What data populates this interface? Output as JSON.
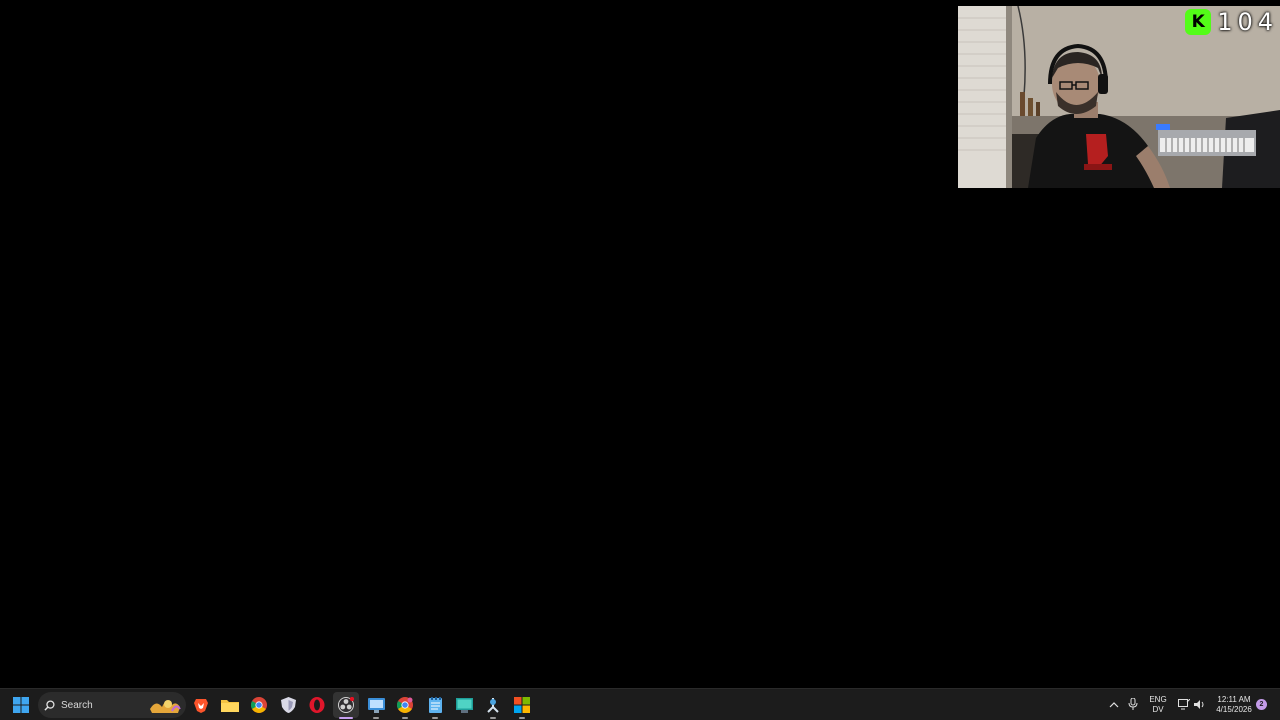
{
  "overlay": {
    "platform_icon": "kick-logo-icon",
    "platform_letter": "K",
    "viewer_count": "104"
  },
  "taskbar": {
    "search_placeholder": "Search",
    "apps": [
      {
        "name": "brave-browser-icon"
      },
      {
        "name": "file-explorer-icon"
      },
      {
        "name": "chrome-browser-icon"
      },
      {
        "name": "shield-app-icon"
      },
      {
        "name": "opera-browser-icon"
      },
      {
        "name": "obs-studio-icon"
      },
      {
        "name": "monitor-app-icon"
      },
      {
        "name": "chrome-canary-icon"
      },
      {
        "name": "notepad-icon"
      },
      {
        "name": "desktop-app-icon"
      },
      {
        "name": "steam-icon"
      },
      {
        "name": "store-app-icon"
      }
    ],
    "tray": {
      "language_line1": "ENG",
      "language_line2": "DV",
      "time": "12:11 AM",
      "date": "4/15/2026",
      "notification_count": "2"
    }
  }
}
